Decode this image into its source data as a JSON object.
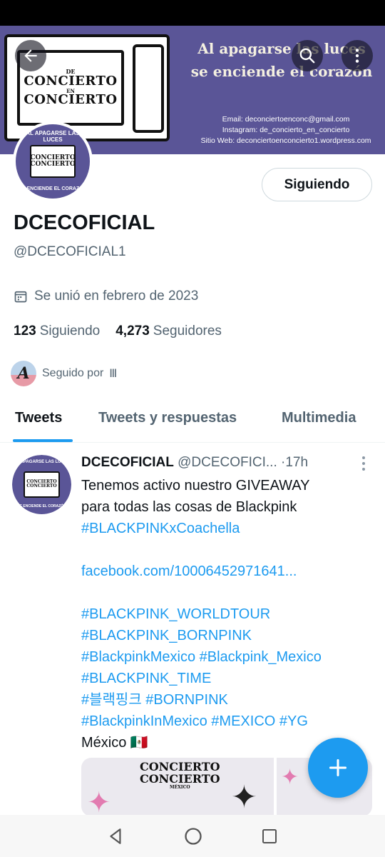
{
  "banner": {
    "logo_lines": [
      "DE",
      "CONCIERTO",
      "EN",
      "CONCIERTO"
    ],
    "slogan_line1": "Al apagarse las luces",
    "slogan_line2": "se enciende el corazón",
    "email": "Email: deconciertoenconc@gmail.com",
    "instagram": "Instagram: de_concierto_en_concierto",
    "website": "Sitio Web: deconciertoenconcierto1.wordpress.com"
  },
  "profile": {
    "avatar_top_text": "AL APAGARSE LAS LUCES",
    "avatar_bottom_text": "SE ENCIENDE EL CORAZÓN",
    "follow_button_label": "Siguiendo",
    "display_name": "DCECOFICIAL",
    "handle": "@DCECOFICIAL1",
    "joined": "Se unió en febrero de 2023",
    "following_count": "123",
    "following_label": "Siguiendo",
    "followers_count": "4,273",
    "followers_label": "Seguidores",
    "followed_by_label": "Seguido por",
    "followed_by_name": "Ⅲ",
    "followed_by_avatar_letter": "A"
  },
  "tabs": [
    {
      "label": "Tweets",
      "active": true
    },
    {
      "label": "Tweets y respuestas",
      "active": false
    },
    {
      "label": "Multimedia",
      "active": false
    }
  ],
  "tweet": {
    "author_name": "DCECOFICIAL",
    "author_handle": "@DCECOFICI...",
    "separator": "·",
    "time": "17h",
    "text_line1": "Tenemos  activo nuestro GIVEAWAY",
    "text_line2": "para todas las cosas de Blackpink",
    "hashtag1": "#BLACKPINKxCoachella",
    "link": "facebook.com/10006452971641...",
    "hashtag_line1": "#BLACKPINK_WORLDTOUR",
    "hashtag_line2": "#BLACKPINK_BORNPINK",
    "hashtag_line3": "#BlackpinkMexico #Blackpink_Mexico",
    "hashtag_line4": "#BLACKPINK_TIME",
    "hashtag_line5": "#블랙핑크 #BORNPINK",
    "hashtag_line6": "#BlackpinkInMexico #MEXICO #YG",
    "location": "México",
    "location_flag": "🇲🇽",
    "media_logo_line1": "CONCIERTO",
    "media_logo_line2": "CONCIERTO",
    "media_logo_small": "MÉXICO"
  },
  "colors": {
    "banner_bg": "#5a5597",
    "accent": "#1d9bf0",
    "secondary_text": "#536471"
  },
  "icons": [
    "back-arrow-icon",
    "search-icon",
    "more-vertical-icon",
    "calendar-icon",
    "plus-icon",
    "nav-back-icon",
    "nav-home-icon",
    "nav-recents-icon"
  ]
}
